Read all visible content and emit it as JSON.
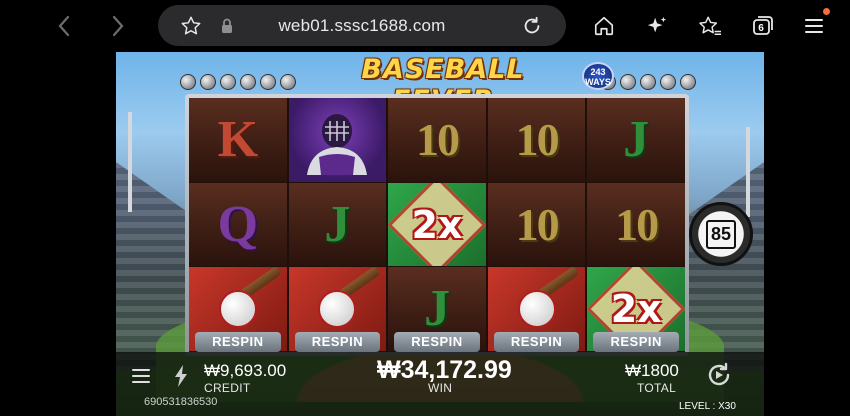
{
  "browser": {
    "url": "web01.sssc1688.com",
    "tab_count": "6",
    "accent": "#ff6b35"
  },
  "game": {
    "title": "BASEBALL FEVER",
    "ways_badge": "243 WAYS",
    "reels": [
      [
        {
          "type": "letter",
          "value": "K"
        },
        {
          "type": "letter",
          "value": "Q"
        },
        {
          "type": "bat-ball",
          "value": ""
        }
      ],
      [
        {
          "type": "catcher",
          "value": ""
        },
        {
          "type": "letter",
          "value": "J"
        },
        {
          "type": "bat-ball",
          "value": ""
        }
      ],
      [
        {
          "type": "letter",
          "value": "10"
        },
        {
          "type": "multiplier",
          "value": "2x"
        },
        {
          "type": "letter",
          "value": "J"
        }
      ],
      [
        {
          "type": "letter",
          "value": "10"
        },
        {
          "type": "letter",
          "value": "10"
        },
        {
          "type": "bat-ball",
          "value": ""
        }
      ],
      [
        {
          "type": "letter",
          "value": "J"
        },
        {
          "type": "letter",
          "value": "10"
        },
        {
          "type": "multiplier",
          "value": "2x"
        }
      ]
    ],
    "respin_label": "RESPIN",
    "counter": "85"
  },
  "footer": {
    "credit_amount": "₩9,693.00",
    "credit_label": "CREDIT",
    "win_amount": "₩34,172.99",
    "win_label": "WIN",
    "total_amount": "₩1800",
    "total_label": "TOTAL",
    "round_id": "690531836530",
    "level_label": "LEVEL :",
    "level_value": "X30"
  }
}
